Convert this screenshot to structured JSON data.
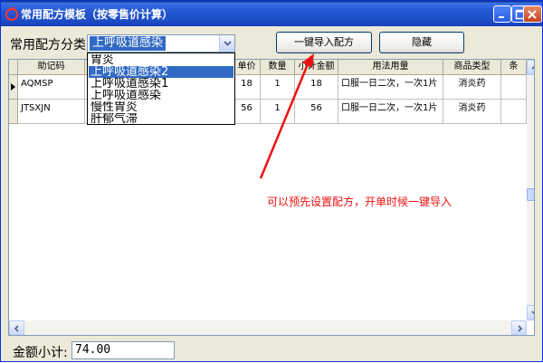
{
  "window": {
    "title": "常用配方模板（按零售价计算）"
  },
  "category": {
    "label": "常用配方分类",
    "selected": "上呼吸道感染"
  },
  "buttons": {
    "import": "一键导入配方",
    "hide": "隐藏"
  },
  "dropdown_options": [
    "胃炎",
    "上呼吸道感染2",
    "上呼吸道感染1",
    "上呼吸道感染",
    "慢性胃炎",
    "肝郁气滞"
  ],
  "grid": {
    "headers": [
      "助记码",
      "单价",
      "数量",
      "小计金额",
      "用法用量",
      "商品类型",
      "条"
    ],
    "rows": [
      {
        "code": "AQMSP",
        "price": "18",
        "qty": "1",
        "subtotal": "18",
        "usage": "口服一日二次，一次1片",
        "type": "消炎药"
      },
      {
        "code": "JTSXJN",
        "price": "56",
        "qty": "1",
        "subtotal": "56",
        "usage": "口服一日二次，一次1片",
        "type": "消炎药"
      }
    ]
  },
  "annotation": "可以预先设置配方，开单时候一键导入",
  "footer": {
    "total_label": "金额小计:",
    "total_value": "74.00"
  },
  "colors": {
    "titlebar": "#2458d3",
    "selection": "#316ac5",
    "annotation": "#ee1111"
  },
  "icons": [
    "app-icon",
    "minimize-icon",
    "maximize-icon",
    "close-icon",
    "dropdown-arrow-icon",
    "row-pointer-icon",
    "scroll-up-icon",
    "scroll-down-icon",
    "scroll-left-icon",
    "scroll-right-icon"
  ]
}
